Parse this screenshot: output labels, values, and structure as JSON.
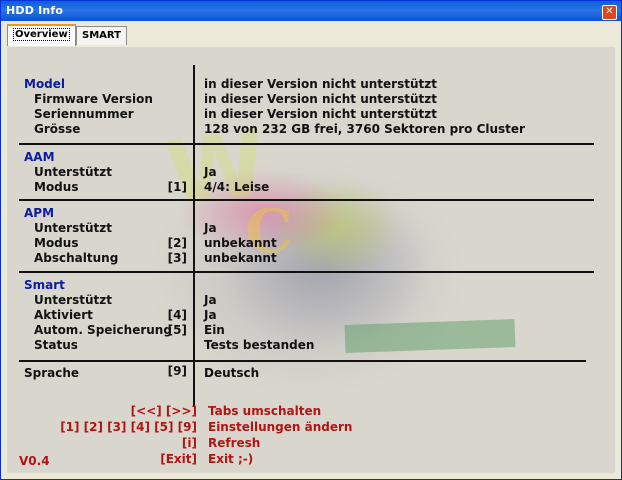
{
  "window": {
    "title": "HDD Info",
    "close_symbol": "✕"
  },
  "tabs": [
    {
      "label": "Overview",
      "active": true
    },
    {
      "label": "SMART",
      "active": false
    }
  ],
  "sections": {
    "model": {
      "header": "Model",
      "header_value": "in dieser Version nicht unterstützt",
      "rows": [
        {
          "label": "Firmware Version",
          "key": "",
          "value": "in dieser Version nicht unterstützt"
        },
        {
          "label": "Seriennummer",
          "key": "",
          "value": "in dieser Version nicht unterstützt"
        },
        {
          "label": "Grösse",
          "key": "",
          "value": "128 von 232 GB frei, 3760 Sektoren pro Cluster"
        }
      ]
    },
    "aam": {
      "header": "AAM",
      "rows": [
        {
          "label": "Unterstützt",
          "key": "",
          "value": "Ja"
        },
        {
          "label": "Modus",
          "key": "[1]",
          "value": "4/4: Leise"
        }
      ]
    },
    "apm": {
      "header": "APM",
      "rows": [
        {
          "label": "Unterstützt",
          "key": "",
          "value": "Ja"
        },
        {
          "label": "Modus",
          "key": "[2]",
          "value": "unbekannt"
        },
        {
          "label": "Abschaltung",
          "key": "[3]",
          "value": "unbekannt"
        }
      ]
    },
    "smart": {
      "header": "Smart",
      "rows": [
        {
          "label": "Unterstützt",
          "key": "",
          "value": "Ja"
        },
        {
          "label": "Aktiviert",
          "key": "[4]",
          "value": "Ja"
        },
        {
          "label": "Autom. Speicherung",
          "key": "[5]",
          "value": "Ein"
        },
        {
          "label": "Status",
          "key": "",
          "value": "Tests bestanden"
        }
      ]
    },
    "language": {
      "label": "Sprache",
      "key": "[9]",
      "value": "Deutsch"
    }
  },
  "footer": [
    {
      "keys": "[<<] [>>]",
      "action": "Tabs umschalten"
    },
    {
      "keys": "[1] [2] [3] [4] [5] [9]",
      "action": "Einstellungen ändern"
    },
    {
      "keys": "[i]",
      "action": "Refresh"
    },
    {
      "keys": "[Exit]",
      "action": "Exit ;-)"
    }
  ],
  "version": "V0.4",
  "colors": {
    "category": "#0b1c9c",
    "footer": "#b21414",
    "title_bar": "#0a5fd8"
  }
}
